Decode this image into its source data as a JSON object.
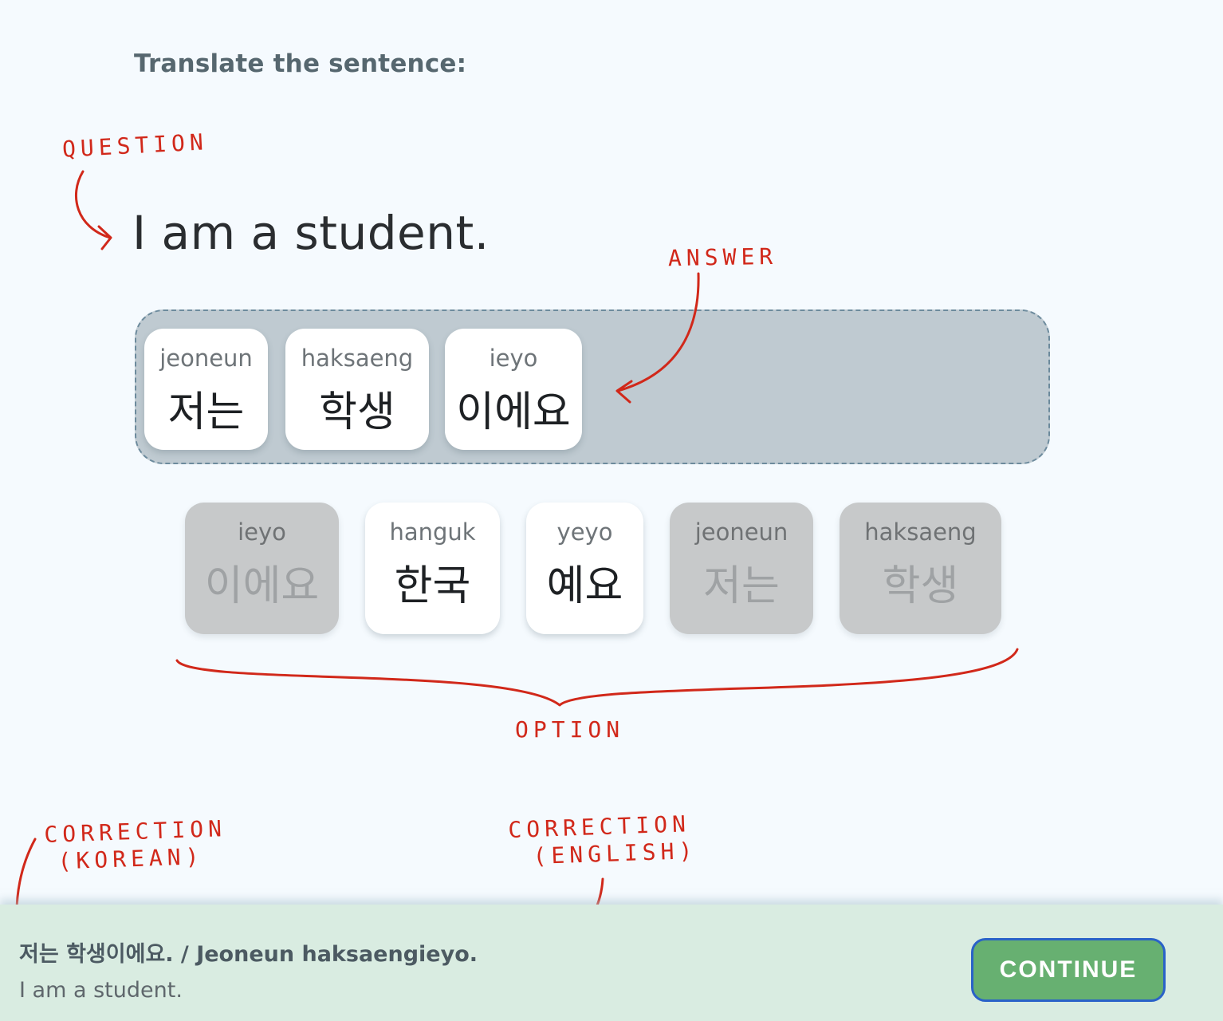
{
  "prompt": "Translate the sentence:",
  "question": "I am a student.",
  "answer_tiles": [
    {
      "romanization": "jeoneun",
      "korean": "저는"
    },
    {
      "romanization": "haksaeng",
      "korean": "학생"
    },
    {
      "romanization": "ieyo",
      "korean": "이에요"
    }
  ],
  "option_tiles": [
    {
      "romanization": "ieyo",
      "korean": "이에요",
      "used": true
    },
    {
      "romanization": "hanguk",
      "korean": "한국",
      "used": false
    },
    {
      "romanization": "yeyo",
      "korean": "예요",
      "used": false
    },
    {
      "romanization": "jeoneun",
      "korean": "저는",
      "used": true
    },
    {
      "romanization": "haksaeng",
      "korean": "학생",
      "used": true
    }
  ],
  "annotations": {
    "question": "QUESTION",
    "answer": "ANSWER",
    "option": "OPTION",
    "correction_korean_line1": "CORRECTION",
    "correction_korean_line2": "(KOREAN)",
    "correction_english_line1": "CORRECTION",
    "correction_english_line2": "(ENGLISH)"
  },
  "footer": {
    "correction_korean": "저는 학생이에요. / Jeoneun haksaengieyo.",
    "correction_english": "I am a student.",
    "continue_label": "CONTINUE"
  },
  "colors": {
    "annotation": "#d1281a",
    "continue_bg": "#67b071",
    "continue_border": "#2a62c8",
    "footer_bg": "#d9ece1",
    "answer_area_bg": "#bfcad1"
  }
}
